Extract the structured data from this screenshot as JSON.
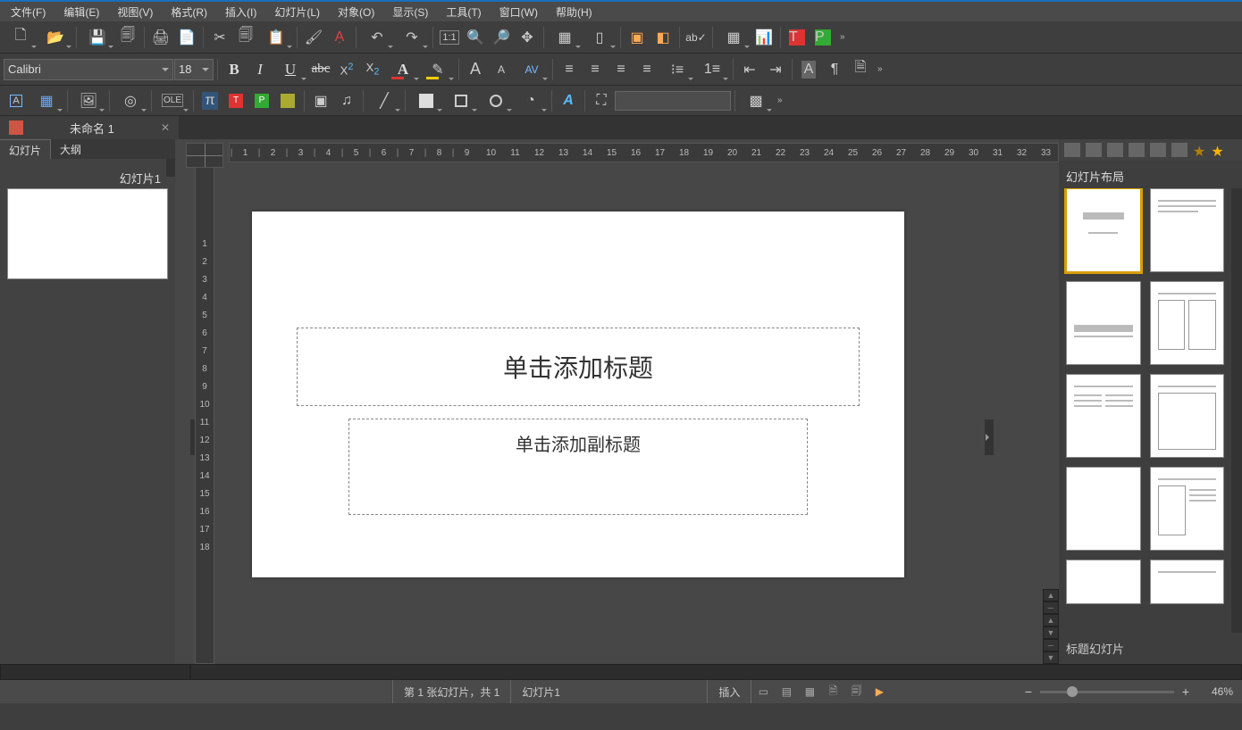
{
  "menu": [
    "文件(F)",
    "编辑(E)",
    "视图(V)",
    "格式(R)",
    "插入(I)",
    "幻灯片(L)",
    "对象(O)",
    "显示(S)",
    "工具(T)",
    "窗口(W)",
    "帮助(H)"
  ],
  "font": {
    "name": "Calibri",
    "size": "18"
  },
  "formatletters": {
    "bold": "B",
    "italic": "I",
    "underline": "U",
    "strike": "abc",
    "super": "X",
    "sub": "X",
    "fontcolor": "A",
    "bigA": "A",
    "smallA": "A",
    "av": "AV",
    "textA": "A"
  },
  "doc": {
    "name": "未命名 1"
  },
  "lefttabs": [
    "幻灯片",
    "大纲"
  ],
  "slideLabel": "幻灯片1",
  "hruler": [
    "1",
    "2",
    "3",
    "4",
    "5",
    "6",
    "7",
    "8",
    "9",
    "10",
    "11",
    "12",
    "13",
    "14",
    "15",
    "16",
    "17",
    "18",
    "19",
    "20",
    "21",
    "22",
    "23",
    "24",
    "25",
    "26",
    "27",
    "28",
    "29",
    "30",
    "31",
    "32",
    "33"
  ],
  "vruler": [
    "1",
    "2",
    "3",
    "4",
    "5",
    "6",
    "7",
    "8",
    "9",
    "10",
    "11",
    "12",
    "13",
    "14",
    "15",
    "16",
    "17",
    "18"
  ],
  "slide": {
    "title": "单击添加标题",
    "subtitle": "单击添加副标题"
  },
  "rp": {
    "layoutsTitle": "幻灯片布局",
    "footer": "标题幻灯片"
  },
  "status": {
    "pos": "第 1 张幻灯片，共 1",
    "name": "幻灯片1",
    "mode": "插入",
    "zoom": "46%"
  },
  "colors": {
    "red": "#c43",
    "green": "#3a3",
    "blue": "#39c",
    "orange": "#d80",
    "yellow": "#fc0"
  }
}
